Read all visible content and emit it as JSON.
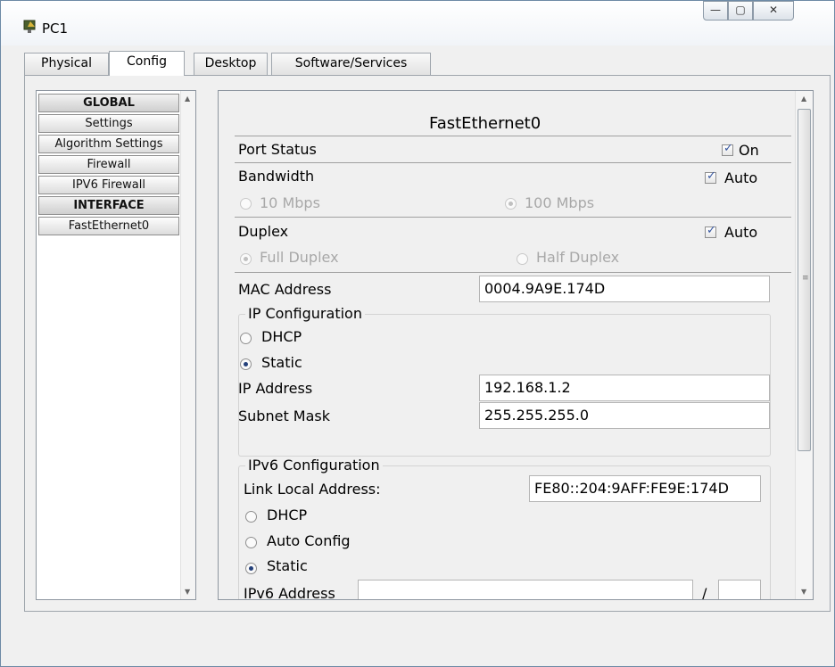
{
  "window": {
    "title": "PC1",
    "controls": {
      "minimize": "—",
      "maximize": "▢",
      "close": "✕"
    }
  },
  "tabs": [
    "Physical",
    "Config",
    "Desktop",
    "Software/Services"
  ],
  "sidebar": {
    "items": [
      "GLOBAL",
      "Settings",
      "Algorithm Settings",
      "Firewall",
      "IPV6 Firewall",
      "INTERFACE",
      "FastEthernet0"
    ]
  },
  "interface": {
    "title": "FastEthernet0",
    "port_status": {
      "label": "Port Status",
      "checkbox_label": "On",
      "checked": true
    },
    "bandwidth": {
      "label": "Bandwidth",
      "checkbox_label": "Auto",
      "checked": true,
      "options": [
        "10 Mbps",
        "100 Mbps"
      ],
      "selected": "100 Mbps"
    },
    "duplex": {
      "label": "Duplex",
      "checkbox_label": "Auto",
      "checked": true,
      "options": [
        "Full Duplex",
        "Half Duplex"
      ],
      "selected": "Full Duplex"
    },
    "mac": {
      "label": "MAC Address",
      "value": "0004.9A9E.174D"
    },
    "ip_config": {
      "legend": "IP Configuration",
      "dhcp_label": "DHCP",
      "static_label": "Static",
      "mode": "Static",
      "ip_label": "IP Address",
      "ip_value": "192.168.1.2",
      "mask_label": "Subnet Mask",
      "mask_value": "255.255.255.0"
    },
    "ipv6_config": {
      "legend": "IPv6 Configuration",
      "link_local_label": "Link Local Address:",
      "link_local_value": "FE80::204:9AFF:FE9E:174D",
      "dhcp_label": "DHCP",
      "auto_label": "Auto Config",
      "static_label": "Static",
      "mode": "Static",
      "addr_label": "IPv6 Address",
      "addr_value": "",
      "prefix_sep": "/",
      "prefix_value": ""
    }
  }
}
